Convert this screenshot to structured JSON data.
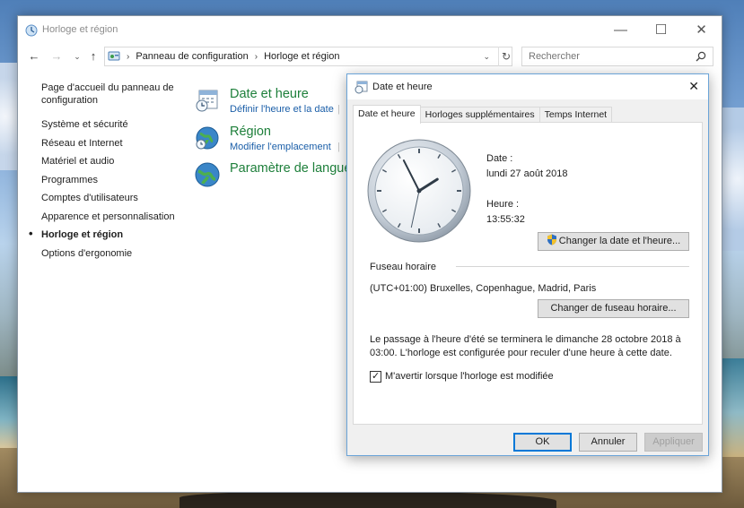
{
  "window": {
    "title": "Horloge et région",
    "minimize": "—",
    "maximize": "☐",
    "close": "✕"
  },
  "nav": {
    "back": "←",
    "forward": "→",
    "recent": "⌄",
    "up": "↑",
    "refresh": "↻",
    "dropdown": "⌄",
    "separator": "›",
    "breadcrumb": [
      "Panneau de configuration",
      "Horloge et région"
    ],
    "search_placeholder": "Rechercher"
  },
  "sidebar": {
    "home": "Page d'accueil du panneau de configuration",
    "items": [
      "Système et sécurité",
      "Réseau et Internet",
      "Matériel et audio",
      "Programmes",
      "Comptes d'utilisateurs",
      "Apparence et personnalisation",
      "Horloge et région",
      "Options d'ergonomie"
    ],
    "active_index": 6
  },
  "categories": [
    {
      "title": "Date et heure",
      "links": [
        "Définir l'heure et la date",
        "|"
      ]
    },
    {
      "title": "Région",
      "links": [
        "Modifier l'emplacement",
        "|"
      ]
    },
    {
      "title": "Paramètre de langue",
      "links": []
    }
  ],
  "dialog": {
    "title": "Date et heure",
    "close": "✕",
    "tabs": [
      "Date et heure",
      "Horloges supplémentaires",
      "Temps Internet"
    ],
    "selected_tab": 0,
    "date_label": "Date :",
    "date_value": "lundi 27 août 2018",
    "time_label": "Heure :",
    "time_value": "13:55:32",
    "change_datetime_button": "Changer la date et l'heure...",
    "timezone_group": "Fuseau horaire",
    "timezone_value": "(UTC+01:00) Bruxelles, Copenhague, Madrid, Paris",
    "change_timezone_button": "Changer de fuseau horaire...",
    "dst_notice": "Le passage à l'heure d'été se terminera le dimanche 28 octobre 2018 à 03:00. L'horloge est configurée pour reculer d'une heure à cette date.",
    "notify_checkbox_label": "M'avertir lorsque l'horloge est modifiée",
    "notify_checked": true,
    "check_mark": "✓",
    "ok_button": "OK",
    "cancel_button": "Annuler",
    "apply_button": "Appliquer"
  },
  "clock": {
    "hours": 13,
    "minutes": 55,
    "seconds": 32
  },
  "colors": {
    "link_green": "#1d7f3a",
    "link_blue": "#1a5ea8",
    "accent": "#0078d7"
  }
}
